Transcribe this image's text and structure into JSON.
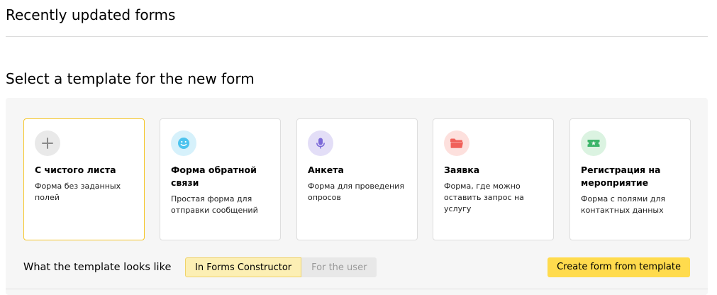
{
  "recent": {
    "title": "Recently updated forms"
  },
  "templates_section": {
    "title": "Select a template for the new form",
    "cards": [
      {
        "title": "С чистого листа",
        "desc": "Форма без заданных полей",
        "icon": "plus-icon",
        "icon_bg": "#e9e9e9",
        "icon_color": "#8a8a8a",
        "selected": true
      },
      {
        "title": "Форма обратной связи",
        "desc": "Простая форма для отправки сообщений",
        "icon": "smile-icon",
        "icon_bg": "#d6f1fb",
        "icon_color": "#4cc3ee",
        "selected": false
      },
      {
        "title": "Анкета",
        "desc": "Форма для проведения опросов",
        "icon": "microphone-icon",
        "icon_bg": "#e3def7",
        "icon_color": "#7b68d8",
        "selected": false
      },
      {
        "title": "Заявка",
        "desc": "Форма, где можно оставить запрос на услугу",
        "icon": "folder-icon",
        "icon_bg": "#fde0dd",
        "icon_color": "#f0615a",
        "selected": false
      },
      {
        "title": "Регистрация на мероприятие",
        "desc": "Форма с полями для контактных данных",
        "icon": "ticket-icon",
        "icon_bg": "#dbf3e1",
        "icon_color": "#3cb56a",
        "selected": false
      }
    ],
    "preview": {
      "label": "What the template looks like",
      "options": [
        "In Forms Constructor",
        "For the user"
      ],
      "selected": "In Forms Constructor"
    },
    "create_button": "Create form from template"
  },
  "colors": {
    "accent": "#ffdb4d",
    "selected_border": "#f5c62a",
    "panel_bg": "#f6f6f6"
  }
}
